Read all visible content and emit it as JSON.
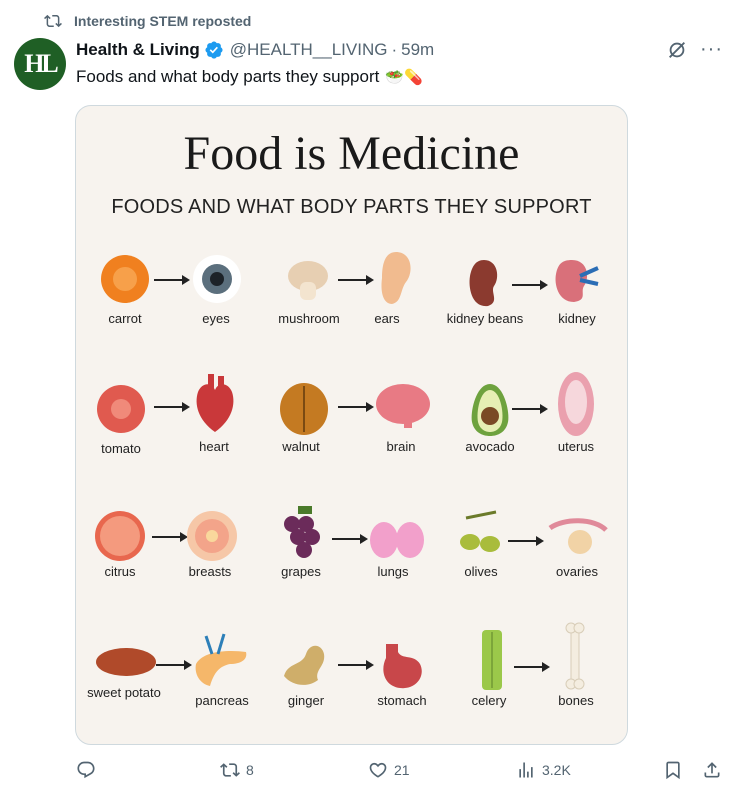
{
  "repost": {
    "label": "Interesting STEM reposted"
  },
  "author": {
    "avatar_text": "HL",
    "name": "Health & Living",
    "handle": "@HEALTH__LIVING",
    "time": "59m"
  },
  "tweet": {
    "text": "Foods and what body parts they support",
    "emoji": "🥗💊"
  },
  "media": {
    "title": "Food is Medicine",
    "subtitle": "FOODS AND WHAT BODY PARTS THEY SUPPORT",
    "pairs": [
      {
        "food": "carrot",
        "part": "eyes"
      },
      {
        "food": "mushroom",
        "part": "ears"
      },
      {
        "food": "kidney beans",
        "part": "kidney"
      },
      {
        "food": "tomato",
        "part": "heart"
      },
      {
        "food": "walnut",
        "part": "brain"
      },
      {
        "food": "avocado",
        "part": "uterus"
      },
      {
        "food": "citrus",
        "part": "breasts"
      },
      {
        "food": "grapes",
        "part": "lungs"
      },
      {
        "food": "olives",
        "part": "ovaries"
      },
      {
        "food": "sweet potato",
        "part": "pancreas"
      },
      {
        "food": "ginger",
        "part": "stomach"
      },
      {
        "food": "celery",
        "part": "bones"
      }
    ]
  },
  "actions": {
    "reply_count": "",
    "repost_count": "8",
    "like_count": "21",
    "views_count": "3.2K"
  },
  "colors": {
    "text": "#0f1419",
    "secondary": "#536471",
    "verified": "#1d9bf0",
    "avatar": "#1f5f25"
  }
}
